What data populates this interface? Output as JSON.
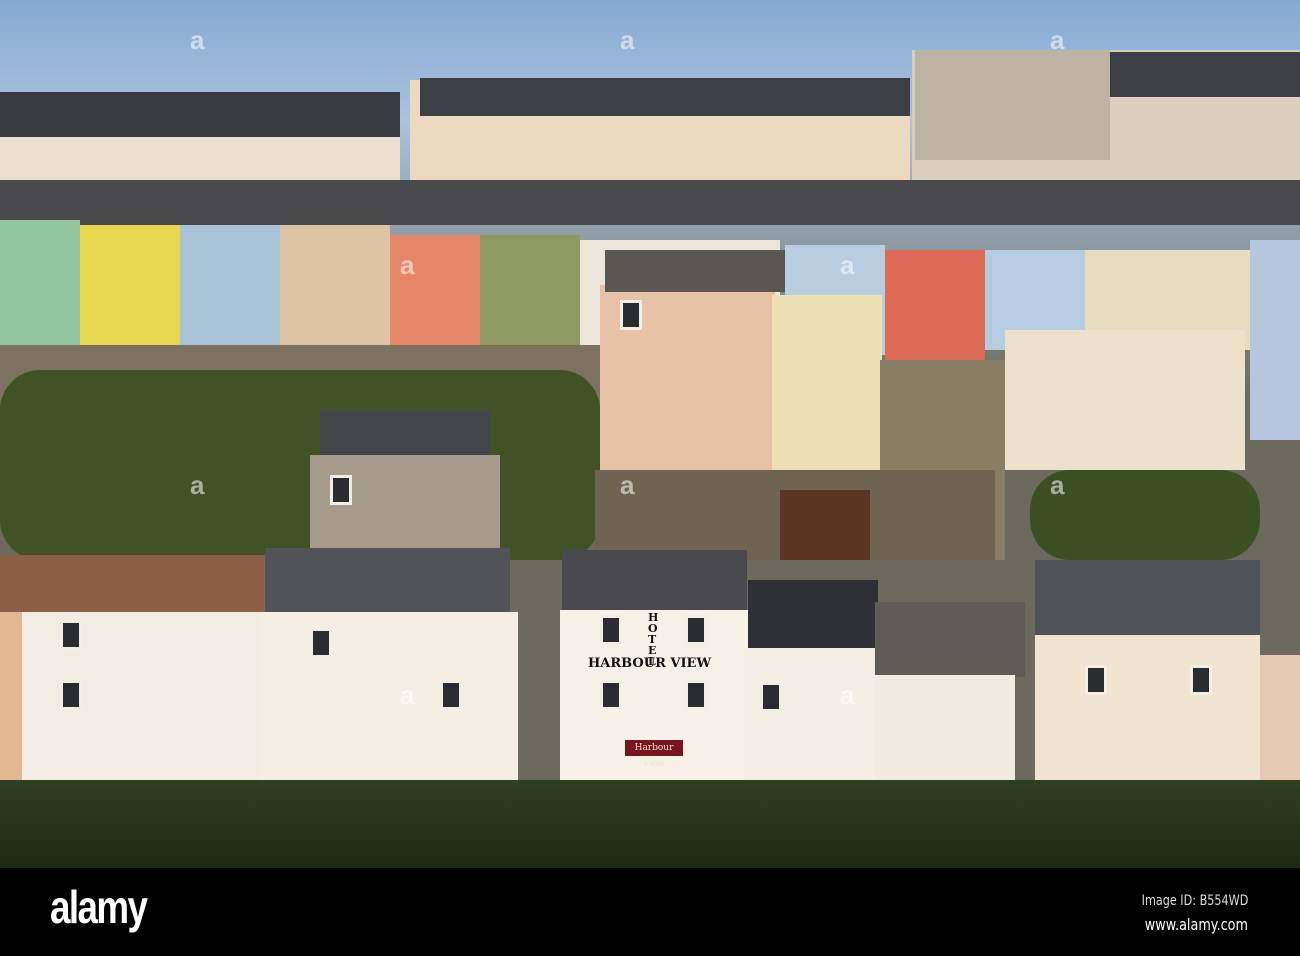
{
  "photo": {
    "subject": "hillside of terraced houses",
    "hotel_sign_vertical": "HOTEL",
    "hotel_sign_main": "HARBOUR VIEW",
    "hotel_canopy_sign": "Harbour View"
  },
  "watermark": {
    "logo": "alamy",
    "image_id": "Image ID: B554WD",
    "url": "www.alamy.com",
    "glyph": "a"
  },
  "colors": {
    "sky": "#86a9d3",
    "hedge": "#1d2a14",
    "bar": "#000000"
  }
}
